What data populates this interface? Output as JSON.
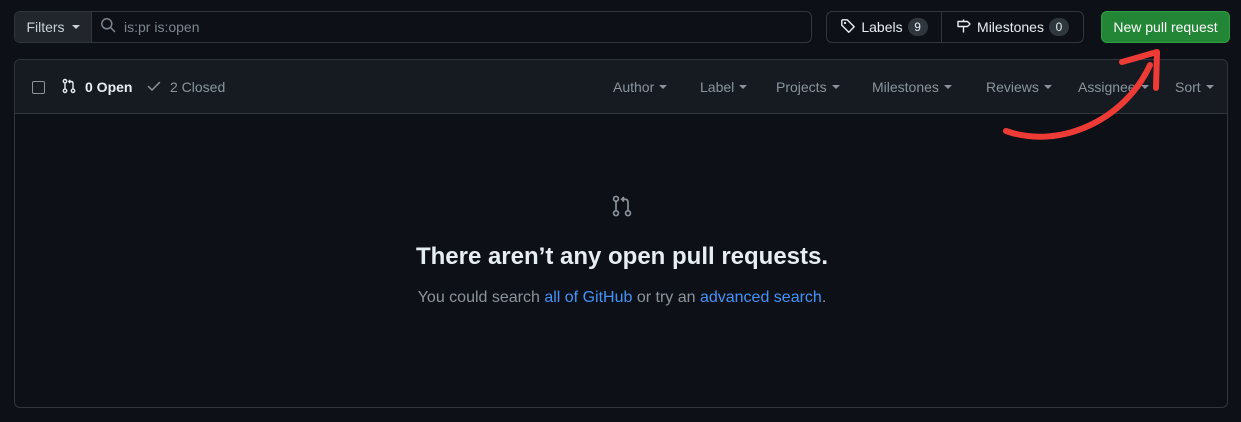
{
  "toolbar": {
    "filters_label": "Filters",
    "search_value": "is:pr is:open",
    "labels": {
      "label": "Labels",
      "count": "9"
    },
    "milestones": {
      "label": "Milestones",
      "count": "0"
    },
    "new_pr_label": "New pull request"
  },
  "list_header": {
    "open_label": "0 Open",
    "closed_label": "2 Closed",
    "filters": [
      "Author",
      "Label",
      "Projects",
      "Milestones",
      "Reviews",
      "Assignee",
      "Sort"
    ]
  },
  "blankslate": {
    "title": "There aren’t any open pull requests.",
    "text_before": "You could search ",
    "link_all": "all of GitHub",
    "text_middle": " or try an ",
    "link_advanced": "advanced search",
    "text_after": "."
  },
  "colors": {
    "background": "#0d1117",
    "header_bg": "#161b22",
    "border": "#30363d",
    "primary_button": "#238636",
    "link": "#4493f8",
    "annotation_arrow": "#ef3b36"
  },
  "icons": [
    "search-icon",
    "tag-icon",
    "milestone-icon",
    "git-pull-request-icon",
    "check-icon",
    "caret-down-icon"
  ]
}
